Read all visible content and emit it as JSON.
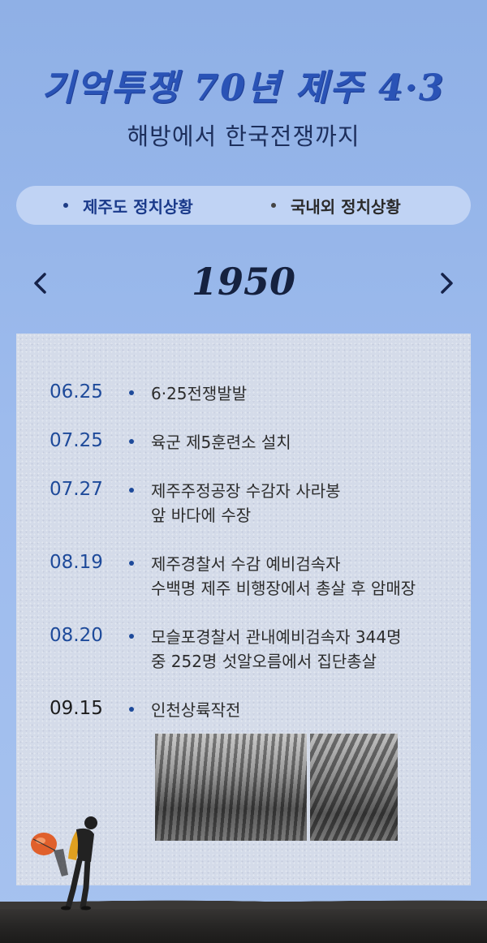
{
  "header": {
    "title": "기억투쟁 70년 제주 4·3",
    "subtitle": "해방에서  한국전쟁까지"
  },
  "tabs": [
    {
      "label": "제주도 정치상황",
      "active": true
    },
    {
      "label": "국내외 정치상황",
      "active": false
    }
  ],
  "year_nav": {
    "year": "1950",
    "prev_icon": "chevron-left-icon",
    "next_icon": "chevron-right-icon"
  },
  "events": [
    {
      "date": "06.25",
      "text": "6·25전쟁발발"
    },
    {
      "date": "07.25",
      "text": "육군 제5훈련소 설치"
    },
    {
      "date": "07.27",
      "text": "제주주정공장 수감자 사라봉\n앞 바다에 수장"
    },
    {
      "date": "08.19",
      "text": "제주경찰서 수감 예비검속자\n수백명 제주 비행장에서 총살 후 암매장"
    },
    {
      "date": "08.20",
      "text": "모슬포경찰서 관내예비검속자 344명\n중 252명 섯알오름에서 집단총살"
    },
    {
      "date": "09.15",
      "text": "인천상륙작전"
    }
  ],
  "colors": {
    "background": "#9dbbed",
    "title": "#2a53b6",
    "accent": "#1e4a9a",
    "panel": "#d4dbe9"
  }
}
